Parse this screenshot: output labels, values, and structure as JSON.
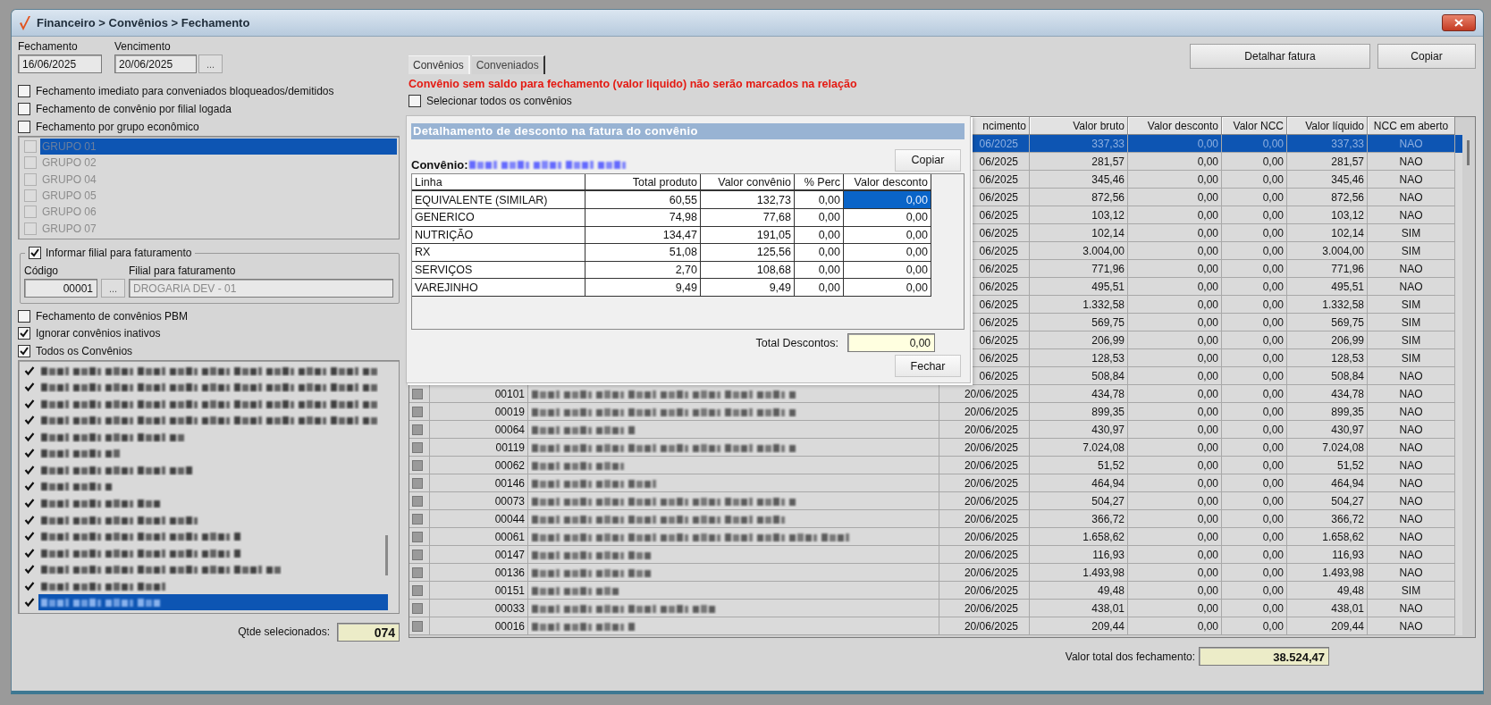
{
  "window": {
    "title": "Financeiro > Convênios > Fechamento"
  },
  "left_panel": {
    "fechamento": {
      "label": "Fechamento",
      "value": "16/06/2025"
    },
    "vencimento": {
      "label": "Vencimento",
      "value": "20/06/2025",
      "button": "..."
    },
    "options": [
      {
        "label": "Fechamento imediato para conveniados bloqueados/demitidos",
        "checked": false
      },
      {
        "label": "Fechamento de convênio por filial logada",
        "checked": false
      },
      {
        "label": "Fechamento por grupo econômico",
        "checked": false
      }
    ],
    "group_list": {
      "enabled": false,
      "items": [
        {
          "label": "GRUPO 01",
          "checked": false,
          "selected": true
        },
        {
          "label": "GRUPO 02",
          "checked": false,
          "selected": false
        },
        {
          "label": "GRUPO 04",
          "checked": false,
          "selected": false
        },
        {
          "label": "GRUPO 05",
          "checked": false,
          "selected": false
        },
        {
          "label": "GRUPO 06",
          "checked": false,
          "selected": false
        },
        {
          "label": "GRUPO 07",
          "checked": false,
          "selected": false
        }
      ]
    },
    "filial_group": {
      "label": "Informar filial para faturamento",
      "checked": true,
      "codigo_label": "Código",
      "codigo_value": "00001",
      "button": "...",
      "filial_label": "Filial para faturamento",
      "filial_value": "DROGARIA DEV - 01"
    },
    "options_2": [
      {
        "label": "Fechamento de convênios PBM",
        "checked": false
      },
      {
        "label": "Ignorar convênios inativos",
        "checked": true
      },
      {
        "label": "Todos os Convênios",
        "checked": true
      }
    ],
    "convenio_list": [
      {
        "checked": true,
        "selected": false
      },
      {
        "checked": true,
        "selected": false
      },
      {
        "checked": true,
        "selected": false
      },
      {
        "checked": true,
        "selected": false
      },
      {
        "checked": true,
        "selected": false
      },
      {
        "checked": true,
        "selected": false
      },
      {
        "checked": true,
        "selected": false
      },
      {
        "checked": true,
        "selected": false
      },
      {
        "checked": true,
        "selected": false
      },
      {
        "checked": true,
        "selected": false
      },
      {
        "checked": true,
        "selected": false
      },
      {
        "checked": true,
        "selected": false
      },
      {
        "checked": true,
        "selected": false
      },
      {
        "checked": true,
        "selected": false
      },
      {
        "checked": true,
        "selected": true
      }
    ],
    "selected_count": {
      "label": "Qtde selecionados:",
      "value": "074"
    }
  },
  "main": {
    "tabs": [
      {
        "label": "Convênios",
        "selected": true
      },
      {
        "label": "Conveniados",
        "selected": false
      }
    ],
    "buttons": [
      "Detalhar fatura",
      "Copiar"
    ],
    "warning": "Convênio sem saldo para fechamento (valor liquido) não serão marcados na relação",
    "select_all": {
      "label": "Selecionar todos os convênios",
      "checked": false
    },
    "grid": {
      "columns": [
        "ncimento",
        "Valor bruto",
        "Valor desconto",
        "Valor NCC",
        "Valor líquido",
        "NCC em aberto"
      ],
      "rows": [
        {
          "vencimento": "06/2025",
          "bruto": "337,33",
          "desconto": "0,00",
          "ncc": "0,00",
          "liquido": "337,33",
          "aberto": "NAO",
          "selected": true
        },
        {
          "vencimento": "06/2025",
          "bruto": "281,57",
          "desconto": "0,00",
          "ncc": "0,00",
          "liquido": "281,57",
          "aberto": "NAO",
          "selected": false
        },
        {
          "vencimento": "06/2025",
          "bruto": "345,46",
          "desconto": "0,00",
          "ncc": "0,00",
          "liquido": "345,46",
          "aberto": "NAO",
          "selected": false
        },
        {
          "vencimento": "06/2025",
          "bruto": "872,56",
          "desconto": "0,00",
          "ncc": "0,00",
          "liquido": "872,56",
          "aberto": "NAO",
          "selected": false
        },
        {
          "vencimento": "06/2025",
          "bruto": "103,12",
          "desconto": "0,00",
          "ncc": "0,00",
          "liquido": "103,12",
          "aberto": "NAO",
          "selected": false
        },
        {
          "vencimento": "06/2025",
          "bruto": "102,14",
          "desconto": "0,00",
          "ncc": "0,00",
          "liquido": "102,14",
          "aberto": "SIM",
          "selected": false
        },
        {
          "vencimento": "06/2025",
          "bruto": "3.004,00",
          "desconto": "0,00",
          "ncc": "0,00",
          "liquido": "3.004,00",
          "aberto": "SIM",
          "selected": false
        },
        {
          "vencimento": "06/2025",
          "bruto": "771,96",
          "desconto": "0,00",
          "ncc": "0,00",
          "liquido": "771,96",
          "aberto": "NAO",
          "selected": false
        },
        {
          "vencimento": "06/2025",
          "bruto": "495,51",
          "desconto": "0,00",
          "ncc": "0,00",
          "liquido": "495,51",
          "aberto": "NAO",
          "selected": false
        },
        {
          "vencimento": "06/2025",
          "bruto": "1.332,58",
          "desconto": "0,00",
          "ncc": "0,00",
          "liquido": "1.332,58",
          "aberto": "SIM",
          "selected": false
        },
        {
          "vencimento": "06/2025",
          "bruto": "569,75",
          "desconto": "0,00",
          "ncc": "0,00",
          "liquido": "569,75",
          "aberto": "SIM",
          "selected": false
        },
        {
          "vencimento": "06/2025",
          "bruto": "206,99",
          "desconto": "0,00",
          "ncc": "0,00",
          "liquido": "206,99",
          "aberto": "SIM",
          "selected": false
        },
        {
          "vencimento": "06/2025",
          "bruto": "128,53",
          "desconto": "0,00",
          "ncc": "0,00",
          "liquido": "128,53",
          "aberto": "SIM",
          "selected": false
        },
        {
          "vencimento": "06/2025",
          "bruto": "508,84",
          "desconto": "0,00",
          "ncc": "0,00",
          "liquido": "508,84",
          "aberto": "NAO",
          "selected": false
        },
        {
          "code": "00101",
          "vencimento": "20/06/2025",
          "bruto": "434,78",
          "desconto": "0,00",
          "ncc": "0,00",
          "liquido": "434,78",
          "aberto": "NAO",
          "selected": false
        },
        {
          "code": "00019",
          "vencimento": "20/06/2025",
          "bruto": "899,35",
          "desconto": "0,00",
          "ncc": "0,00",
          "liquido": "899,35",
          "aberto": "NAO",
          "selected": false
        },
        {
          "code": "00064",
          "vencimento": "20/06/2025",
          "bruto": "430,97",
          "desconto": "0,00",
          "ncc": "0,00",
          "liquido": "430,97",
          "aberto": "NAO",
          "selected": false
        },
        {
          "code": "00119",
          "vencimento": "20/06/2025",
          "bruto": "7.024,08",
          "desconto": "0,00",
          "ncc": "0,00",
          "liquido": "7.024,08",
          "aberto": "NAO",
          "selected": false
        },
        {
          "code": "00062",
          "vencimento": "20/06/2025",
          "bruto": "51,52",
          "desconto": "0,00",
          "ncc": "0,00",
          "liquido": "51,52",
          "aberto": "NAO",
          "selected": false
        },
        {
          "code": "00146",
          "vencimento": "20/06/2025",
          "bruto": "464,94",
          "desconto": "0,00",
          "ncc": "0,00",
          "liquido": "464,94",
          "aberto": "NAO",
          "selected": false
        },
        {
          "code": "00073",
          "vencimento": "20/06/2025",
          "bruto": "504,27",
          "desconto": "0,00",
          "ncc": "0,00",
          "liquido": "504,27",
          "aberto": "NAO",
          "selected": false
        },
        {
          "code": "00044",
          "vencimento": "20/06/2025",
          "bruto": "366,72",
          "desconto": "0,00",
          "ncc": "0,00",
          "liquido": "366,72",
          "aberto": "NAO",
          "selected": false
        },
        {
          "code": "00061",
          "vencimento": "20/06/2025",
          "bruto": "1.658,62",
          "desconto": "0,00",
          "ncc": "0,00",
          "liquido": "1.658,62",
          "aberto": "NAO",
          "selected": false
        },
        {
          "code": "00147",
          "vencimento": "20/06/2025",
          "bruto": "116,93",
          "desconto": "0,00",
          "ncc": "0,00",
          "liquido": "116,93",
          "aberto": "NAO",
          "selected": false
        },
        {
          "code": "00136",
          "vencimento": "20/06/2025",
          "bruto": "1.493,98",
          "desconto": "0,00",
          "ncc": "0,00",
          "liquido": "1.493,98",
          "aberto": "NAO",
          "selected": false
        },
        {
          "code": "00151",
          "vencimento": "20/06/2025",
          "bruto": "49,48",
          "desconto": "0,00",
          "ncc": "0,00",
          "liquido": "49,48",
          "aberto": "SIM",
          "selected": false
        },
        {
          "code": "00033",
          "vencimento": "20/06/2025",
          "bruto": "438,01",
          "desconto": "0,00",
          "ncc": "0,00",
          "liquido": "438,01",
          "aberto": "NAO",
          "selected": false
        },
        {
          "code": "00016",
          "vencimento": "20/06/2025",
          "bruto": "209,44",
          "desconto": "0,00",
          "ncc": "0,00",
          "liquido": "209,44",
          "aberto": "NAO",
          "selected": false
        }
      ]
    },
    "total": {
      "label": "Valor total dos fechamento:",
      "value": "38.524,47"
    }
  },
  "dialog": {
    "title": "Detalhamento de desconto na fatura do convênio",
    "convenio_label": "Convênio:",
    "copy_button": "Copiar",
    "columns": [
      "Linha",
      "Total produto",
      "Valor convênio",
      "% Perc",
      "Valor desconto"
    ],
    "rows": [
      {
        "linha": "EQUIVALENTE (SIMILAR)",
        "total_produto": "60,55",
        "valor_convenio": "132,73",
        "perc": "0,00",
        "valor_desconto": "0,00",
        "selected": true
      },
      {
        "linha": "GENERICO",
        "total_produto": "74,98",
        "valor_convenio": "77,68",
        "perc": "0,00",
        "valor_desconto": "0,00",
        "selected": false
      },
      {
        "linha": "NUTRIÇÃO",
        "total_produto": "134,47",
        "valor_convenio": "191,05",
        "perc": "0,00",
        "valor_desconto": "0,00",
        "selected": false
      },
      {
        "linha": "RX",
        "total_produto": "51,08",
        "valor_convenio": "125,56",
        "perc": "0,00",
        "valor_desconto": "0,00",
        "selected": false
      },
      {
        "linha": "SERVIÇOS",
        "total_produto": "2,70",
        "valor_convenio": "108,68",
        "perc": "0,00",
        "valor_desconto": "0,00",
        "selected": false
      },
      {
        "linha": "VAREJINHO",
        "total_produto": "9,49",
        "valor_convenio": "9,49",
        "perc": "0,00",
        "valor_desconto": "0,00",
        "selected": false
      }
    ],
    "total_label": "Total Descontos:",
    "total_value": "0,00",
    "close_button": "Fechar"
  }
}
